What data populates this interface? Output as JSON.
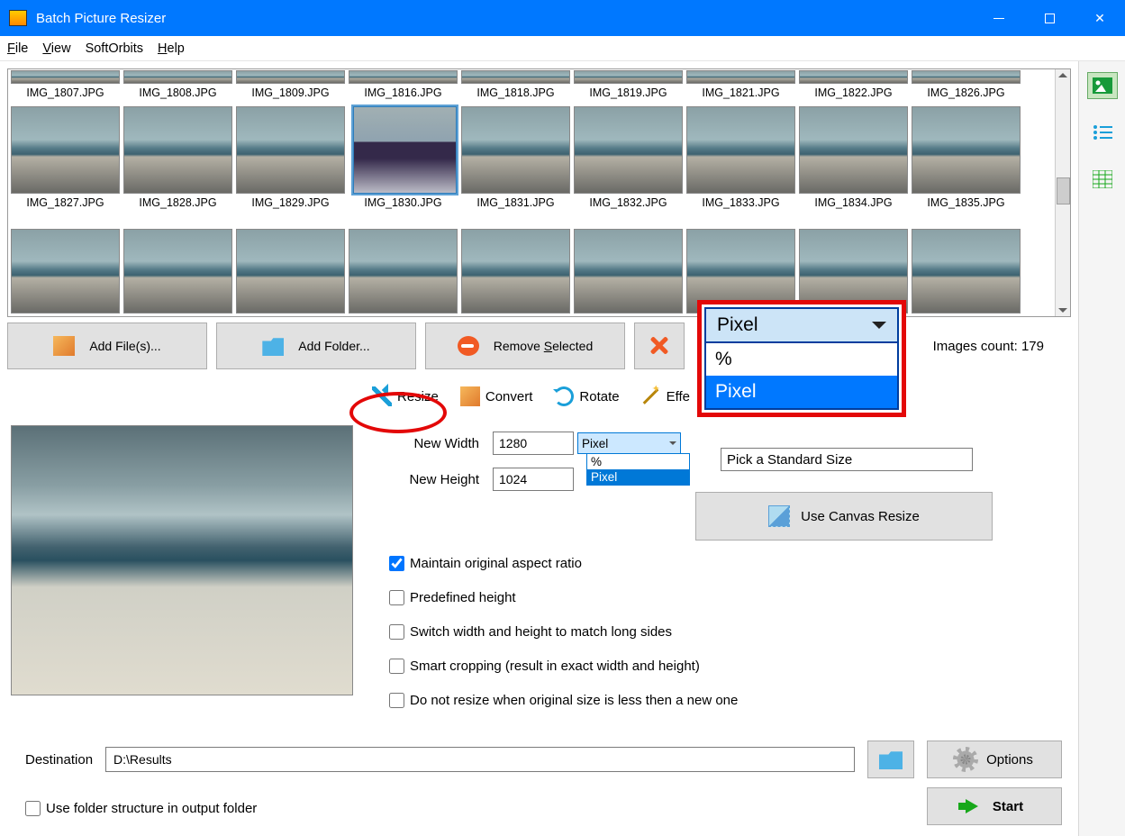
{
  "title": "Batch Picture Resizer",
  "menu": {
    "file": "File",
    "view": "View",
    "softorbits": "SoftOrbits",
    "help": "Help"
  },
  "gallery": {
    "row1": [
      "IMG_1807.JPG",
      "IMG_1808.JPG",
      "IMG_1809.JPG",
      "IMG_1816.JPG",
      "IMG_1818.JPG",
      "IMG_1819.JPG",
      "IMG_1821.JPG",
      "IMG_1822.JPG",
      "IMG_1826.JPG"
    ],
    "row2": [
      "IMG_1827.JPG",
      "IMG_1828.JPG",
      "IMG_1829.JPG",
      "IMG_1830.JPG",
      "IMG_1831.JPG",
      "IMG_1832.JPG",
      "IMG_1833.JPG",
      "IMG_1834.JPG",
      "IMG_1835.JPG"
    ],
    "selected": "IMG_1830.JPG"
  },
  "buttons": {
    "add_files": "Add File(s)...",
    "add_folder": "Add Folder...",
    "remove_selected": "Remove Selected",
    "use_canvas": "Use Canvas Resize",
    "options": "Options",
    "start": "Start"
  },
  "count_label": "Images count: 179",
  "tabs": {
    "resize": "Resize",
    "convert": "Convert",
    "rotate": "Rotate",
    "effects": "Effe"
  },
  "resize": {
    "new_width_label": "New Width",
    "new_height_label": "New Height",
    "width_value": "1280",
    "height_value": "1024",
    "unit_selected": "Pixel",
    "unit_options": [
      "%",
      "Pixel"
    ],
    "std_size_placeholder": "Pick a Standard Size",
    "chk_aspect": "Maintain original aspect ratio",
    "chk_predef": "Predefined height",
    "chk_switch": "Switch width and height to match long sides",
    "chk_smart": "Smart cropping (result in exact width and height)",
    "chk_noresize": "Do not resize when original size is less then a new one"
  },
  "big_dropdown": {
    "selected": "Pixel",
    "options": [
      "%",
      "Pixel"
    ]
  },
  "destination": {
    "label": "Destination",
    "path": "D:\\Results",
    "use_folder_structure": "Use folder structure in output folder"
  }
}
